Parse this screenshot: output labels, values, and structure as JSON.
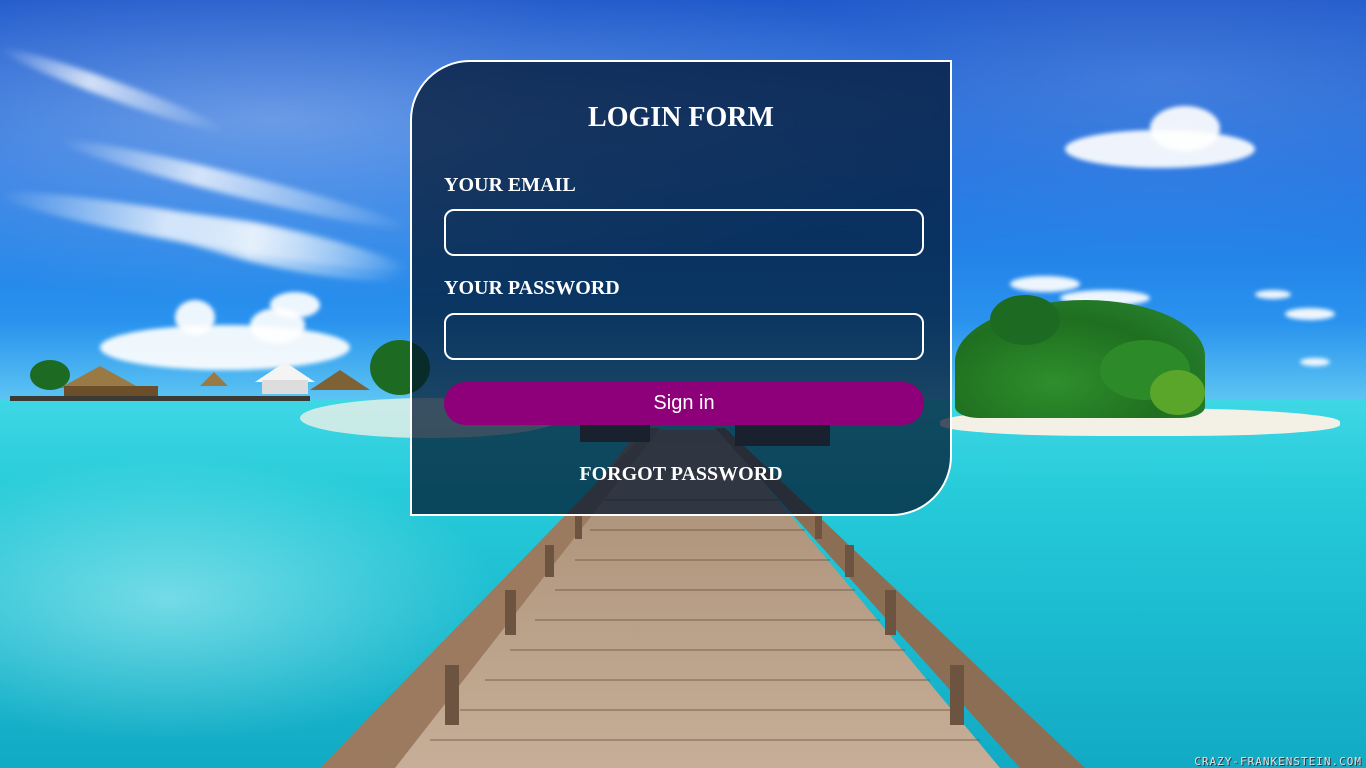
{
  "login": {
    "title": "LOGIN FORM",
    "email_label": "YOUR EMAIL",
    "email_value": "",
    "password_label": "YOUR PASSWORD",
    "password_value": "",
    "signin_label": "Sign in",
    "forgot_label": "FORGOT PASSWORD"
  },
  "background": {
    "watermark": "CRAZY-FRANKENSTEIN.COM"
  },
  "colors": {
    "card_background": "#00142d",
    "signin_button": "#8e0079",
    "border": "#ffffff"
  }
}
